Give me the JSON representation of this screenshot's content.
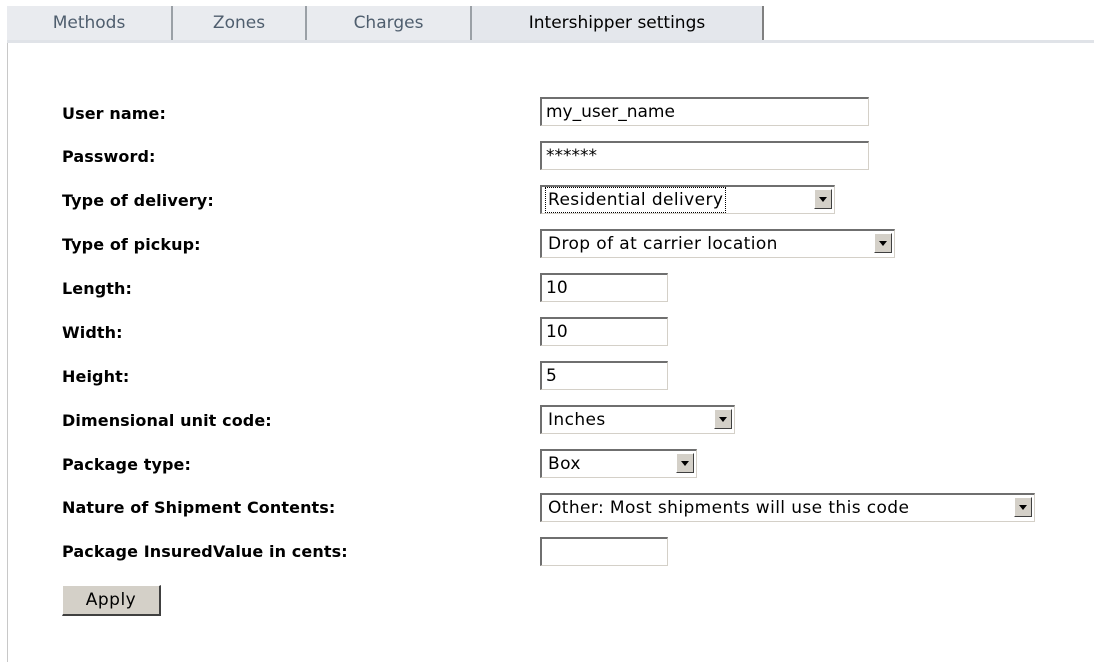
{
  "tabs": [
    {
      "label": "Methods",
      "active": false
    },
    {
      "label": "Zones",
      "active": false
    },
    {
      "label": "Charges",
      "active": false
    },
    {
      "label": "Intershipper settings",
      "active": true
    }
  ],
  "form": {
    "user_name": {
      "label": "User name:",
      "value": "my_user_name"
    },
    "password": {
      "label": "Password:",
      "value": "******"
    },
    "delivery_type": {
      "label": "Type of delivery:",
      "selected": "Residential delivery"
    },
    "pickup_type": {
      "label": "Type of pickup:",
      "selected": "Drop of at carrier location"
    },
    "length": {
      "label": "Length:",
      "value": "10"
    },
    "width": {
      "label": "Width:",
      "value": "10"
    },
    "height": {
      "label": "Height:",
      "value": "5"
    },
    "dimensional_unit": {
      "label": "Dimensional unit code:",
      "selected": "Inches"
    },
    "package_type": {
      "label": "Package type:",
      "selected": "Box"
    },
    "contents_nature": {
      "label": "Nature of Shipment Contents:",
      "selected": "Other: Most shipments will use this code"
    },
    "insured_value": {
      "label": "Package InsuredValue in cents:",
      "value": ""
    },
    "apply_label": "Apply"
  },
  "colors": {
    "tab_bg": "#e9ebef",
    "tab_text": "#4f5e6e",
    "button_face": "#d4d0c8"
  }
}
